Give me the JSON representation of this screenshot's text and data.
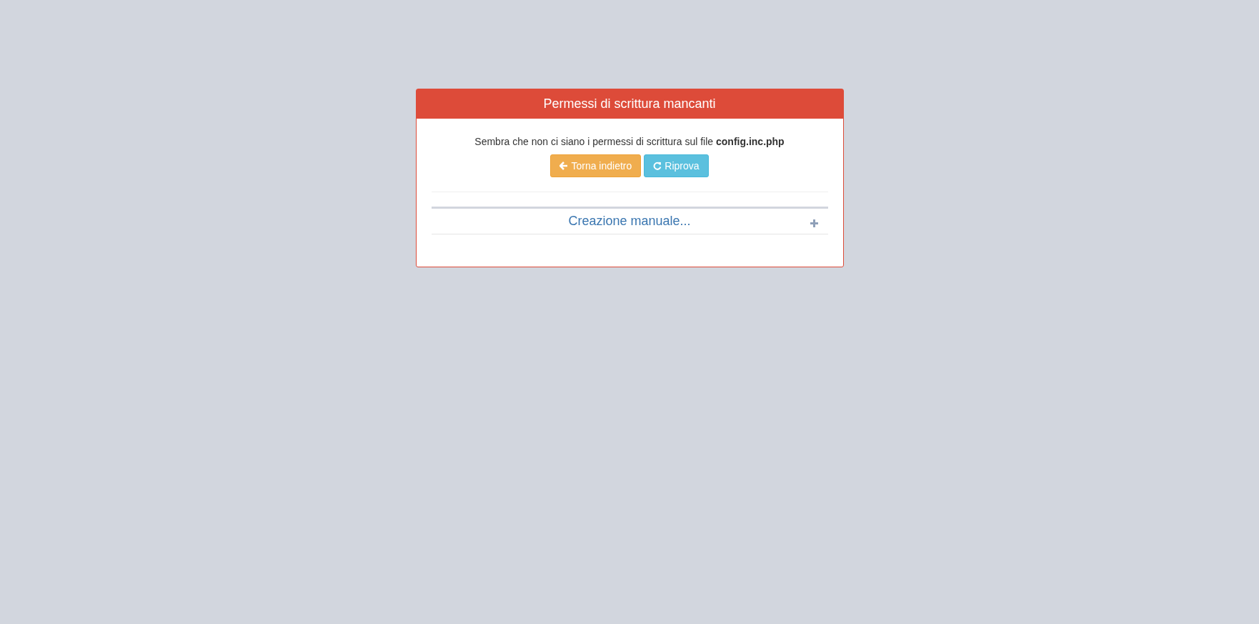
{
  "dialog": {
    "title": "Permessi di scrittura mancanti",
    "message": "Sembra che non ci siano i permessi di scrittura sul file **config.inc.php**",
    "buttons": [
      {
        "label": "Torna indietro",
        "kind": "back"
      },
      {
        "label": "Riprova",
        "kind": "retry"
      }
    ],
    "collapsible": {
      "title": "Creazione manuale...",
      "expanded": false
    }
  }
}
